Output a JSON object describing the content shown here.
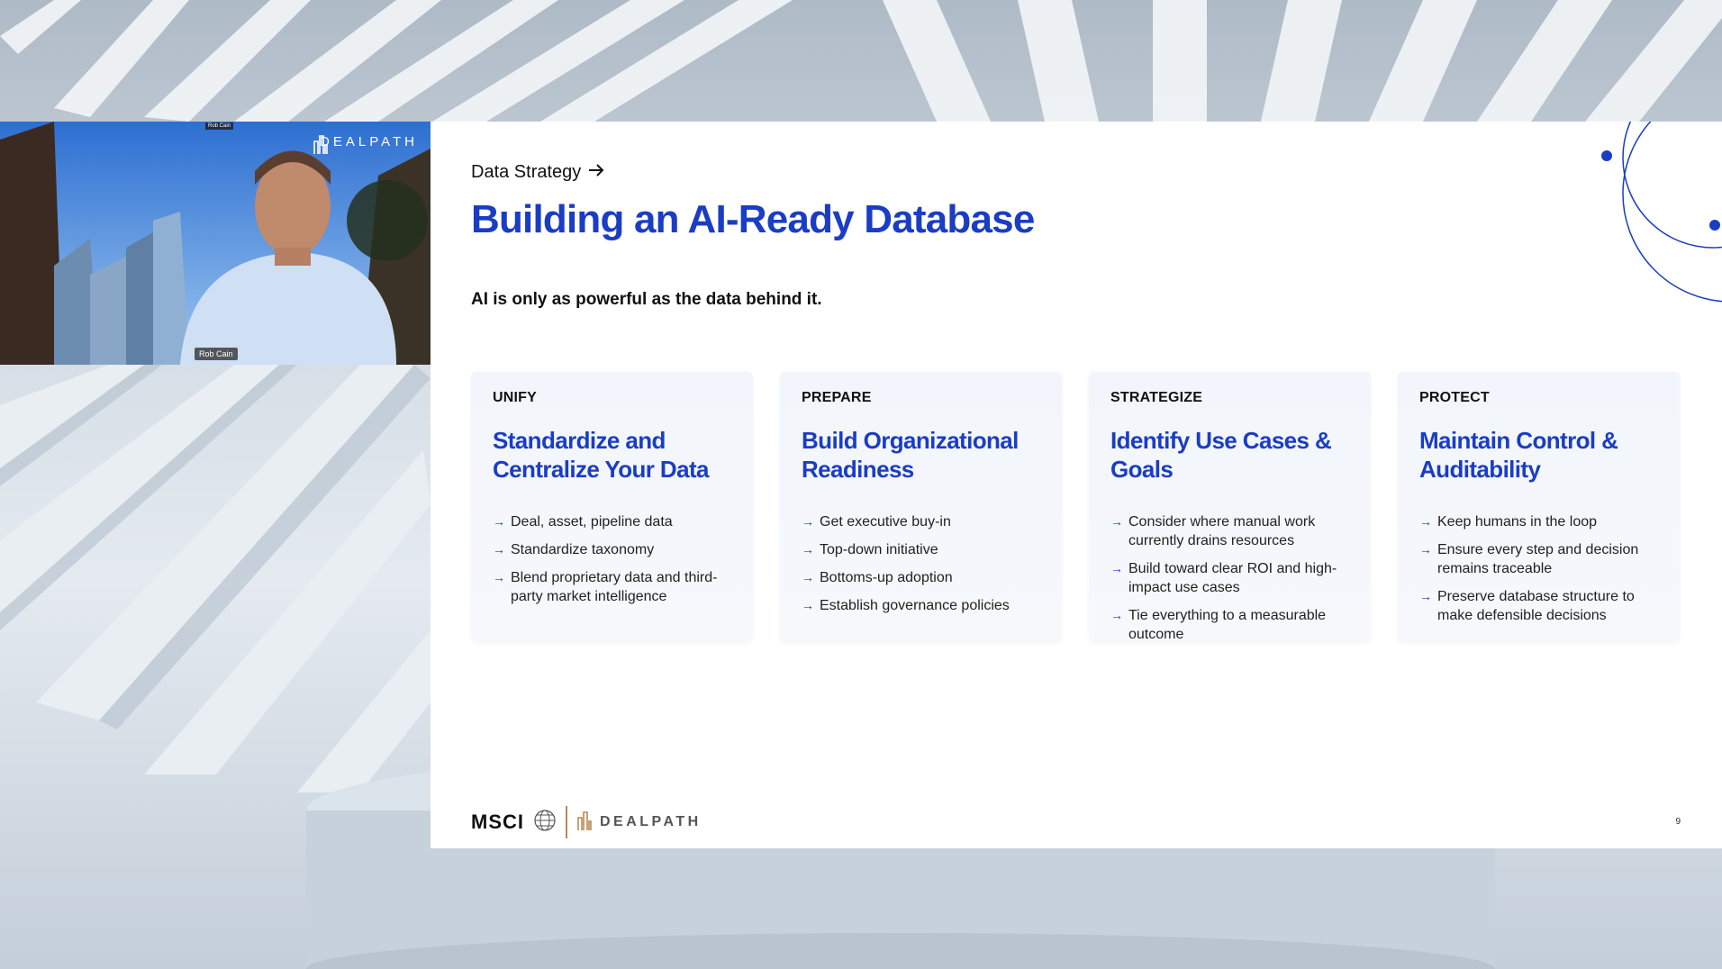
{
  "video": {
    "participant_name": "Rob Cain",
    "brand_logo": "DEALPATH",
    "top_label": "Rob Cain"
  },
  "slide": {
    "eyebrow": "Data Strategy",
    "title": "Building an AI-Ready Database",
    "subtitle": "AI is only as powerful as the data behind it.",
    "cards": [
      {
        "tag": "UNIFY",
        "heading": "Standardize and Centralize Your Data",
        "items": [
          "Deal, asset, pipeline data",
          "Standardize taxonomy",
          "Blend proprietary data and third-party market intelligence"
        ]
      },
      {
        "tag": "PREPARE",
        "heading": "Build Organizational Readiness",
        "items": [
          "Get executive buy-in",
          "Top-down initiative",
          "Bottoms-up adoption",
          "Establish governance policies"
        ]
      },
      {
        "tag": "STRATEGIZE",
        "heading": "Identify Use Cases & Goals",
        "items": [
          "Consider where manual work currently drains resources",
          "Build toward clear ROI and high-impact use cases",
          "Tie everything to a measurable outcome"
        ]
      },
      {
        "tag": "PROTECT",
        "heading": "Maintain Control & Auditability",
        "items": [
          "Keep humans in the loop",
          "Ensure every step and decision remains traceable",
          "Preserve database structure to make defensible decisions"
        ]
      }
    ],
    "footer": {
      "msci": "MSCI",
      "dealpath": "DEALPATH"
    },
    "page_number": "9"
  },
  "colors": {
    "accent": "#1a3dc4",
    "card_bg": "#f2f5fb",
    "divider": "#b78a58"
  },
  "icons": {
    "eyebrow_arrow": "arrow-right-icon",
    "bullet": "arrow-right-icon",
    "globe": "globe-icon",
    "building": "building-logo-icon"
  }
}
